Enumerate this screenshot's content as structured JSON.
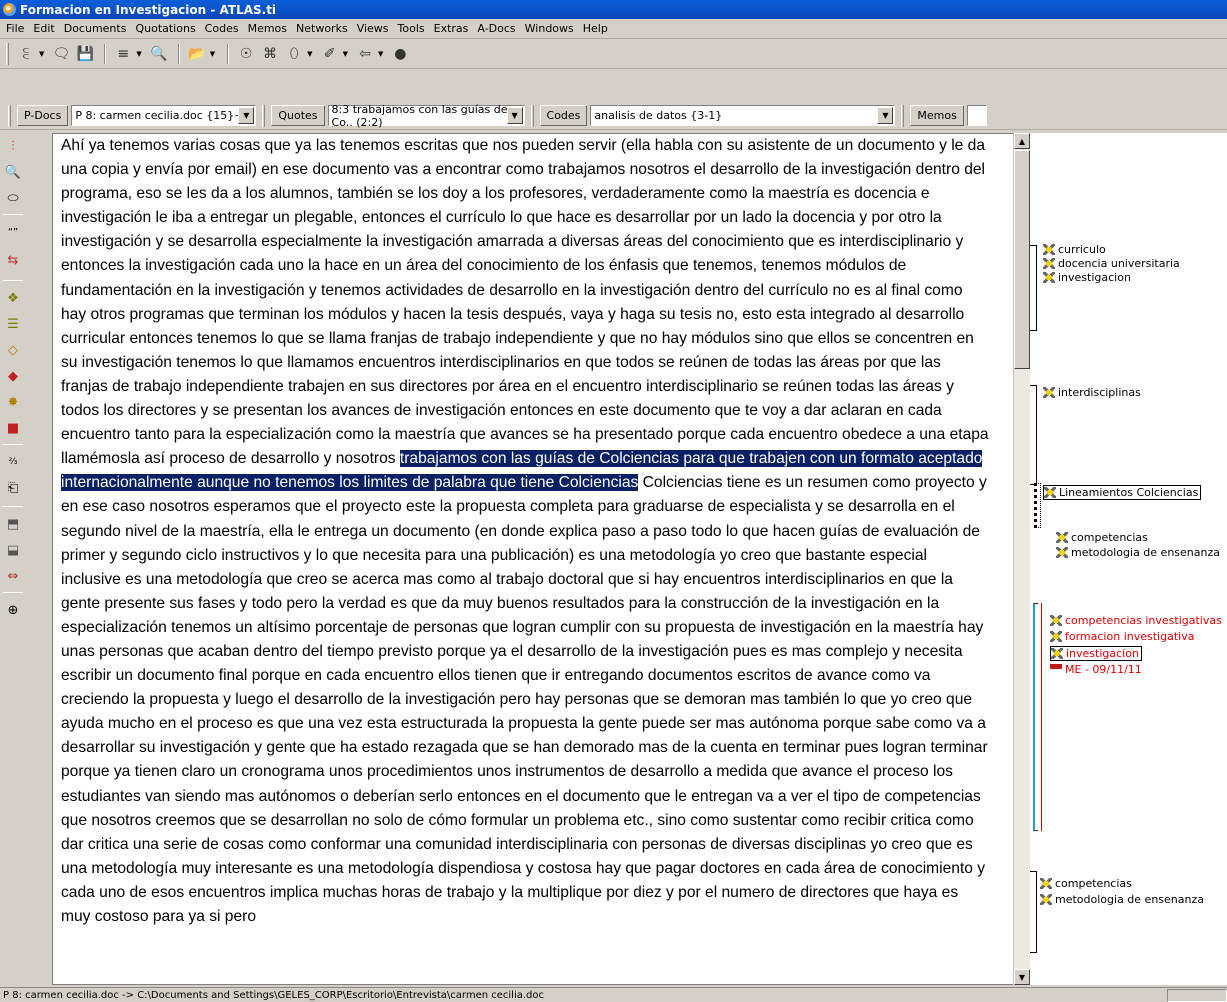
{
  "window": {
    "title": "Formacion en Investigacion - ATLAS.ti"
  },
  "menu": [
    "File",
    "Edit",
    "Documents",
    "Quotations",
    "Codes",
    "Memos",
    "Networks",
    "Views",
    "Tools",
    "Extras",
    "A-Docs",
    "Windows",
    "Help"
  ],
  "toolbar": {
    "icons": [
      "add-document-icon",
      "comment-icon",
      "save-icon",
      "split-icon",
      "find-icon",
      "open-icon",
      "query-icon",
      "code-manager-icon",
      "xml-icon",
      "tool-icon",
      "back-icon",
      "bomb-icon"
    ]
  },
  "selectors": {
    "pdocs_label": "P-Docs",
    "pdocs_value": "P 8: carmen cecilia.doc {15}~",
    "quotes_label": "Quotes",
    "quotes_value": "8:3 trabajamos con las guías de Co.. (2:2)",
    "codes_label": "Codes",
    "codes_value": "analisis de datos {3-1}",
    "memos_label": "Memos"
  },
  "document": {
    "before_selection": "Ahí ya tenemos varias cosas que ya las tenemos escritas que nos pueden servir (ella habla con su asistente de un documento y le da una copia y envía por email) en ese documento vas a encontrar como trabajamos nosotros el desarrollo de la investigación dentro del programa, eso se les da a los alumnos, también se los doy a los profesores, verdaderamente como la maestría es docencia e investigación le iba a entregar un plegable, entonces el currículo lo que hace es desarrollar por un lado la docencia y por otro la investigación y se desarrolla especialmente la investigación amarrada a diversas áreas del conocimiento que es interdisciplinario y entonces la investigación cada uno la hace en un área del conocimiento de los énfasis que tenemos, tenemos módulos de fundamentación en la investigación y tenemos actividades de desarrollo en la investigación dentro del currículo no es al final como hay otros programas que terminan los módulos y hacen la tesis después, vaya y haga su tesis no, esto esta integrado al desarrollo curricular entonces tenemos lo que se llama franjas de trabajo independiente y que no hay módulos sino que ellos se concentren en su investigación tenemos lo que llamamos encuentros interdisciplinarios en que todos se reúnen de todas las áreas por que las franjas de trabajo independiente trabajen en sus directores por área en el encuentro interdisciplinario se reúnen todas las áreas y todos los directores y se presentan los avances de investigación entonces en este documento que te voy a dar aclaran en cada encuentro tanto para la especialización como la maestría que avances se ha presentado porque cada encuentro obedece a una etapa llamémosla así proceso de desarrollo y nosotros ",
    "selection": "trabajamos con las guías de Colciencias para que trabajen con un formato aceptado internacionalmente aunque no tenemos los limites de palabra que tiene Colciencias",
    "after_selection": " Colciencias tiene es un resumen como proyecto y en ese caso nosotros esperamos que el proyecto este la propuesta completa para graduarse de especialista y se desarrolla en el segundo nivel de la maestría, ella le entrega un documento (en donde explica paso a paso todo lo que hacen guías de evaluación de primer y segundo ciclo instructivos y lo que necesita para una publicación) es una metodología yo creo que bastante especial inclusive es una metodología que creo se acerca mas como al trabajo doctoral que si hay encuentros interdisciplinarios en que la gente presente sus fases y todo pero la verdad es que da muy buenos resultados para la construcción de la investigación en la especialización tenemos un altísimo porcentaje de personas que logran cumplir con su propuesta de investigación en la maestría hay unas personas que acaban dentro del tiempo previsto porque ya el desarrollo de la investigación pues es mas complejo y necesita escribir un documento final porque en cada encuentro ellos tienen que ir entregando documentos escritos de avance como va creciendo la propuesta y luego el desarrollo de la investigación pero hay personas que se demoran mas también lo que yo creo que ayuda mucho en el proceso es que una vez esta estructurada la propuesta la gente puede ser mas autónoma porque sabe como va a desarrollar su investigación y gente que ha estado rezagada que se han demorado mas de la cuenta en terminar pues logran terminar porque ya tienen claro un cronograma unos procedimientos unos instrumentos de desarrollo a medida que avance el proceso los estudiantes van siendo mas autónomos o deberían serlo entonces en el documento que le entregan va a ver el tipo de competencias que nosotros creemos que se desarrollan no solo de cómo formular un problema etc., sino como sustentar como recibir critica como dar critica una serie de cosas como conformar una comunidad interdisciplinaria con personas de diversas disciplinas yo creo que es una metodología muy interesante es una metodología dispendiosa y costosa hay que pagar doctores en cada área de conocimiento y cada uno de esos encuentros implica muchas horas de trabajo y la multiplique por diez y por el numero de directores que haya es muy costoso para ya si pero"
  },
  "margin_codes": {
    "group1": [
      "curriculo",
      "docencia universitaria",
      "investigacion"
    ],
    "group2": [
      "interdisciplinas"
    ],
    "group3": [
      "Lineamientos Colciencias"
    ],
    "group4": [
      "competencias",
      "metodologia de ensenanza"
    ],
    "group5": [
      "competencias investigativas",
      "formacion investigativa",
      "investigacion"
    ],
    "memo": "ME - 09/11/11",
    "group6": [
      "competencias",
      "metodologia de ensenanza"
    ]
  },
  "status": {
    "text": "P 8: carmen cecilia.doc -> C:\\Documents and Settings\\GELES_CORP\\Escritorio\\Entrevista\\carmen cecilia.doc"
  },
  "colors": {
    "highlight": "#0a2166",
    "titlebar": "#0a5fd8",
    "code_red": "#e00000"
  }
}
